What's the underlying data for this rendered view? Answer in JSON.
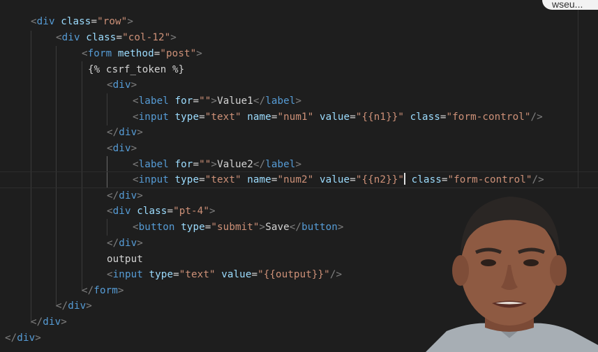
{
  "colors": {
    "background": "#1e1e1e",
    "tag": "#569cd6",
    "attribute": "#9cdcfe",
    "string": "#ce9178",
    "text": "#d4d4d4",
    "punctuation": "#808080"
  },
  "badge": {
    "text": "wseu..."
  },
  "code": {
    "l1": {
      "a": "<",
      "b": "div",
      "c": " class",
      "d": "=",
      "e": "\"row\"",
      "f": ">"
    },
    "l2": {
      "a": "<",
      "b": "div",
      "c": " class",
      "d": "=",
      "e": "\"col-12\"",
      "f": ">"
    },
    "l3": {
      "a": "<",
      "b": "form",
      "c": " method",
      "d": "=",
      "e": "\"post\"",
      "f": ">"
    },
    "l4": {
      "a": "{% csrf_token %}"
    },
    "l5": {
      "a": "<",
      "b": "div",
      "f": ">"
    },
    "l6": {
      "a": "<",
      "b": "label",
      "c": " for",
      "d": "=",
      "e": "\"\"",
      "f": ">",
      "g": "Value1",
      "h": "</",
      "i": "label",
      "j": ">"
    },
    "l7": {
      "a": "<",
      "b": "input",
      "c": " type",
      "d": "=",
      "e": "\"text\"",
      "c2": " name",
      "e2": "\"num1\"",
      "c3": " value",
      "e3": "\"{{n1}}\"",
      "c4": " class",
      "e4": "\"form-control\"",
      "f": "/>"
    },
    "l8": {
      "a": "</",
      "b": "div",
      "f": ">"
    },
    "l9": {
      "a": "<",
      "b": "div",
      "f": ">"
    },
    "l10": {
      "a": "<",
      "b": "label",
      "c": " for",
      "d": "=",
      "e": "\"\"",
      "f": ">",
      "g": "Value2",
      "h": "</",
      "i": "label",
      "j": ">"
    },
    "l11": {
      "a": "<",
      "b": "input",
      "c": " type",
      "d": "=",
      "e": "\"text\"",
      "c2": " name",
      "e2": "\"num2\"",
      "c3": " value",
      "e3": "\"{{n2}}\"",
      "c4": " class",
      "e4": "\"form-control\"",
      "f": "/>"
    },
    "l12": {
      "a": "</",
      "b": "div",
      "f": ">"
    },
    "l13": {
      "a": "<",
      "b": "div",
      "c": " class",
      "d": "=",
      "e": "\"pt-4\"",
      "f": ">"
    },
    "l14": {
      "a": "<",
      "b": "button",
      "c": " type",
      "d": "=",
      "e": "\"submit\"",
      "f": ">",
      "g": "Save",
      "h": "</",
      "i": "button",
      "j": ">"
    },
    "l15": {
      "a": "</",
      "b": "div",
      "f": ">"
    },
    "l16": {
      "g": "output"
    },
    "l17": {
      "a": "<",
      "b": "input",
      "c": " type",
      "d": "=",
      "e": "\"text\"",
      "c2": " value",
      "e2": "\"{{output}}\"",
      "f": "/>"
    },
    "l18": {
      "a": "</",
      "b": "form",
      "f": ">"
    },
    "l19": {
      "a": "</",
      "b": "div",
      "f": ">"
    },
    "l20": {
      "a": "</",
      "b": "div",
      "f": ">"
    },
    "l21": {
      "a": "</",
      "b": "div",
      "f": ">"
    }
  }
}
